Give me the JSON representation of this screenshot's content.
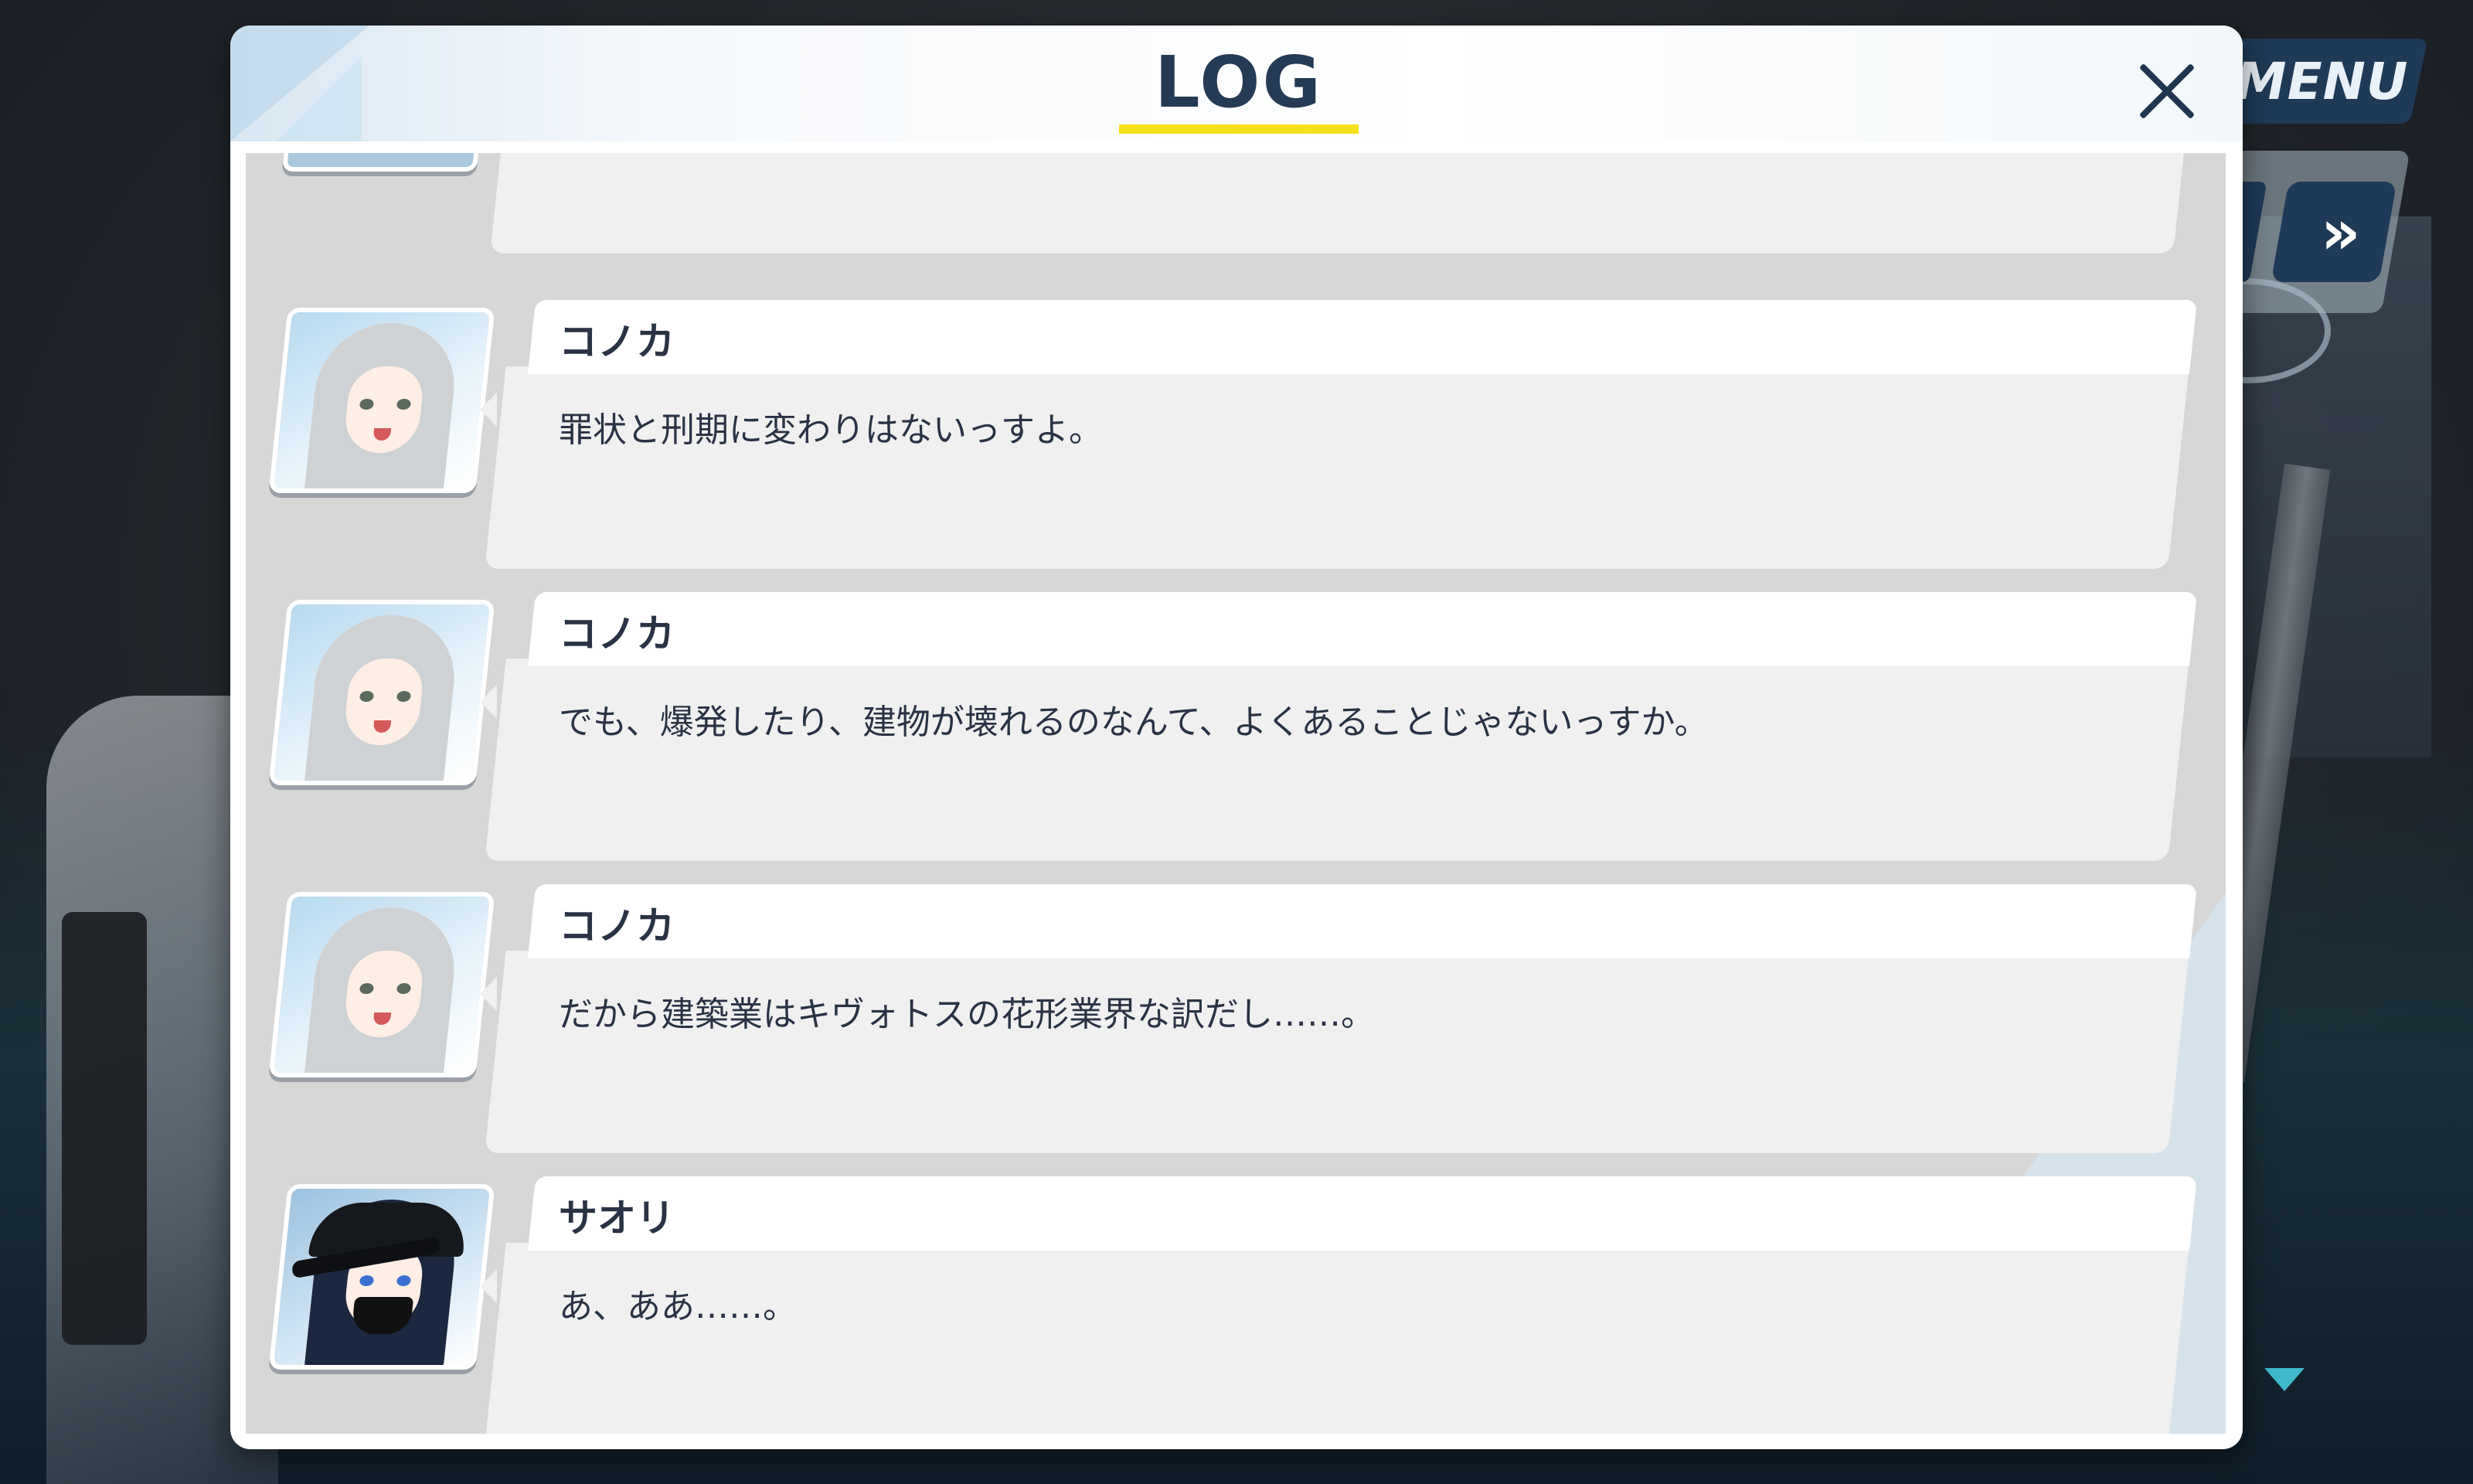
{
  "hud": {
    "menu_label": "MENU",
    "skip_label": "»",
    "colors": {
      "hud_bg": "#1f3a57",
      "down_arrow": "#3fb8c9"
    }
  },
  "log": {
    "title": "LOG",
    "close_icon": "close-icon",
    "colors": {
      "title": "#253a55",
      "underline": "#f6e01a",
      "body_bg": "#d7d7d7",
      "bubble": "#f0f0f0"
    },
    "entries": [
      {
        "speaker": "コノカ",
        "text": "罪状と刑期に変わりはないっすよ。",
        "avatar": "konoka-avatar"
      },
      {
        "speaker": "コノカ",
        "text": "でも、爆発したり、建物が壊れるのなんて、よくあることじゃないっすか。",
        "avatar": "konoka-avatar"
      },
      {
        "speaker": "コノカ",
        "text": "だから建築業はキヴォトスの花形業界な訳だし……。",
        "avatar": "konoka-avatar"
      },
      {
        "speaker": "サオリ",
        "text": "あ、ああ……。",
        "avatar": "saori-avatar"
      }
    ]
  }
}
